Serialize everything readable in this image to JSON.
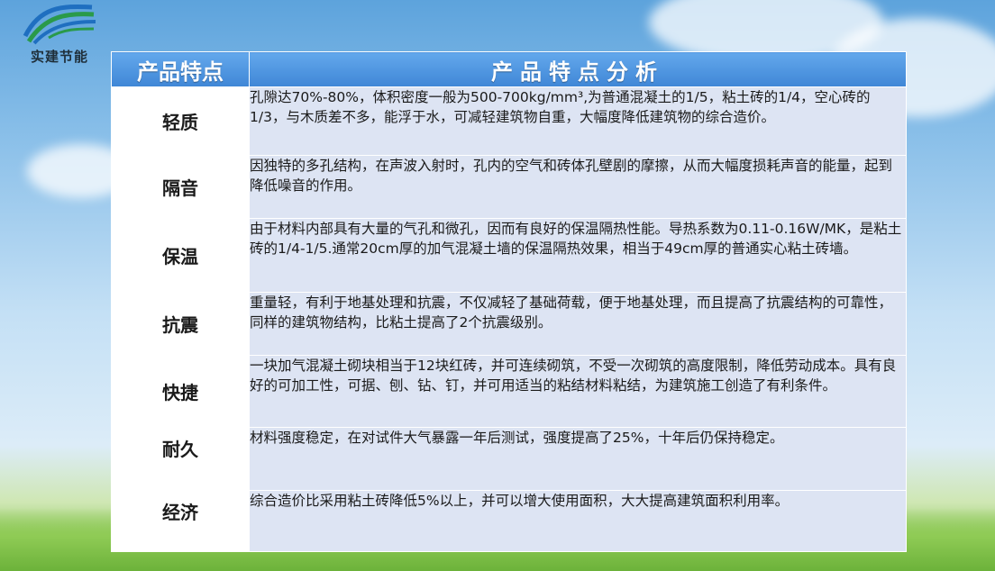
{
  "logo": {
    "icon": "company-logo-icon",
    "text": "实建节能"
  },
  "table": {
    "headers": {
      "feature": "产品特点",
      "analysis": "产品特点分析"
    },
    "rows": [
      {
        "feature": "轻质",
        "description": "孔隙达70%-80%，体积密度一般为500-700kg/mm³,为普通混凝土的1/5，粘土砖的1/4，空心砖的1/3，与木质差不多，能浮于水，可减轻建筑物自重，大幅度降低建筑物的综合造价。"
      },
      {
        "feature": "隔音",
        "description": "因独特的多孔结构，在声波入射时，孔内的空气和砖体孔壁剧的摩擦，从而大幅度损耗声音的能量，起到降低噪音的作用。"
      },
      {
        "feature": "保温",
        "description": " 由于材料内部具有大量的气孔和微孔，因而有良好的保温隔热性能。导热系数为0.11-0.16W/MK，是粘土砖的1/4-1/5.通常20cm厚的加气混凝土墙的保温隔热效果，相当于49cm厚的普通实心粘土砖墙。"
      },
      {
        "feature": "抗震",
        "description": "重量轻，有利于地基处理和抗震，不仅减轻了基础荷载，便于地基处理，而且提高了抗震结构的可靠性，同样的建筑物结构，比粘土提高了2个抗震级别。"
      },
      {
        "feature": "快捷",
        "description": "一块加气混凝土砌块相当于12块红砖，并可连续砌筑，不受一次砌筑的高度限制，降低劳动成本。具有良好的可加工性，可据、刨、钻、钉，并可用适当的粘结材料粘结，为建筑施工创造了有利条件。"
      },
      {
        "feature": "耐久",
        "description": "材料强度稳定，在对试件大气暴露一年后测试，强度提高了25%，十年后仍保持稳定。"
      },
      {
        "feature": "经济",
        "description": "综合造价比采用粘土砖降低5%以上，并可以增大使用面积，大大提高建筑面积利用率。"
      }
    ]
  }
}
